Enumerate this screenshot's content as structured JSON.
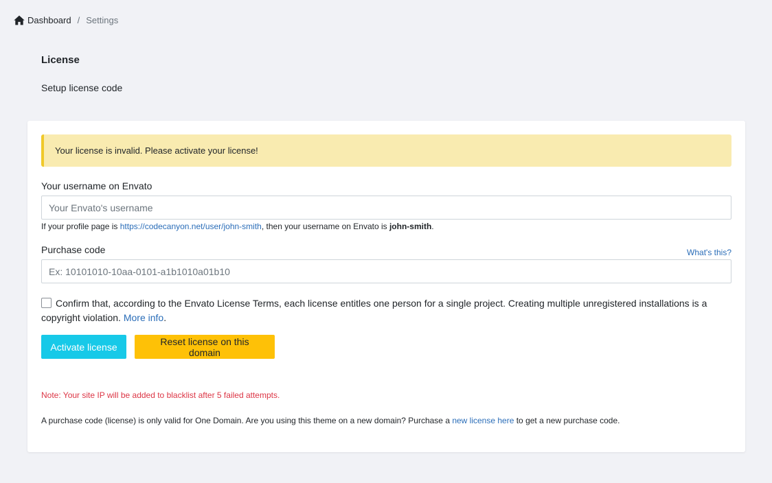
{
  "breadcrumb": {
    "home_icon": "home-icon",
    "home_label": "Dashboard",
    "separator": "/",
    "current": "Settings"
  },
  "page": {
    "title": "License",
    "subtitle": "Setup license code"
  },
  "alert": {
    "text": "Your license is invalid. Please activate your license!",
    "color": "#f9ebb0",
    "border_color": "#f0c92a"
  },
  "username": {
    "label": "Your username on Envato",
    "placeholder": "Your Envato's username",
    "value": "",
    "help_prefix": "If your profile page is ",
    "help_link": "https://codecanyon.net/user/john-smith",
    "help_middle": ", then your username on Envato is ",
    "help_bold": "john-smith",
    "help_suffix": "."
  },
  "purchase_code": {
    "label": "Purchase code",
    "whats_this": "What's this?",
    "placeholder": "Ex: 10101010-10aa-0101-a1b1010a01b10",
    "value": ""
  },
  "confirm": {
    "checked": false,
    "text": "Confirm that, according to the Envato License Terms, each license entitles one person for a single project. Creating multiple unregistered installations is a copyright violation. ",
    "more_info": "More info",
    "suffix": "."
  },
  "buttons": {
    "activate": "Activate license",
    "reset": "Reset license on this domain",
    "activate_color": "#17c9e8",
    "reset_color": "#fec107"
  },
  "notes": {
    "blacklist": "Note: Your site IP will be added to blacklist after 5 failed attempts.",
    "info_prefix": "A purchase code (license) is only valid for One Domain. Are you using this theme on a new domain? Purchase a ",
    "info_link": "new license here",
    "info_suffix": " to get a new purchase code."
  }
}
